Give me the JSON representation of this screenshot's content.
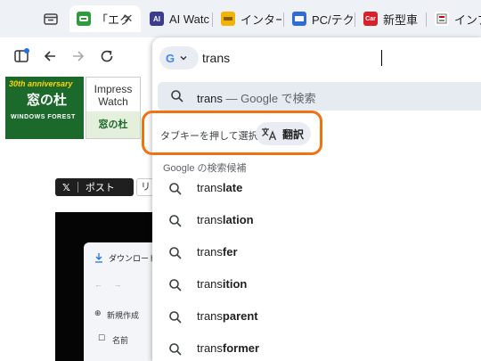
{
  "tabs": [
    {
      "title": "「エク",
      "favicon": "green-leaf-icon",
      "color": "#2e9b3d",
      "active": true,
      "close": "✕"
    },
    {
      "title": "AI Watc",
      "favicon": "ai-watch-icon",
      "color": "#3b3c8f",
      "favicon_text": "AI"
    },
    {
      "title": "インターネ",
      "favicon": "internet-watch-icon",
      "color": "#f2b400"
    },
    {
      "title": "PC/テク",
      "favicon": "pc-watch-icon",
      "color": "#2f6bd9"
    },
    {
      "title": "新型車",
      "favicon": "car-watch-icon",
      "color": "#d8202a",
      "favicon_text": "Car"
    },
    {
      "title": "インプレ",
      "favicon": "impress-icon",
      "color": "#7a7a7a"
    }
  ],
  "omnibox": {
    "engine": "G",
    "query": "trans",
    "top_suggestion": {
      "query": "trans",
      "separator": " — ",
      "action": "Google で検索"
    },
    "tab_hint": "タブキーを押して選択:",
    "keyword_chip": "翻訳",
    "group_header": "Google の検索候補",
    "suggestions": [
      {
        "bold": "trans",
        "rest": "late"
      },
      {
        "bold": "trans",
        "rest": "lation"
      },
      {
        "bold": "trans",
        "rest": "fer"
      },
      {
        "bold": "trans",
        "rest": "ition"
      },
      {
        "bold": "trans",
        "rest": "parent"
      },
      {
        "bold": "trans",
        "rest": "former"
      }
    ]
  },
  "page": {
    "logo_top": "30th anniversary",
    "logo_main": "窓の杜",
    "logo_bottom": "WINDOWS FOREST",
    "impress_label": "Impress Watch",
    "madonomori_tab": "窓の杜",
    "share_x": "ポスト",
    "share_other": "リ",
    "explorer": {
      "title": "ダウンロード",
      "new_button": "新規作成",
      "column_name": "名前"
    }
  },
  "colors": {
    "accent_ring": "#f07212",
    "tabstrip": "#eef1f6"
  }
}
